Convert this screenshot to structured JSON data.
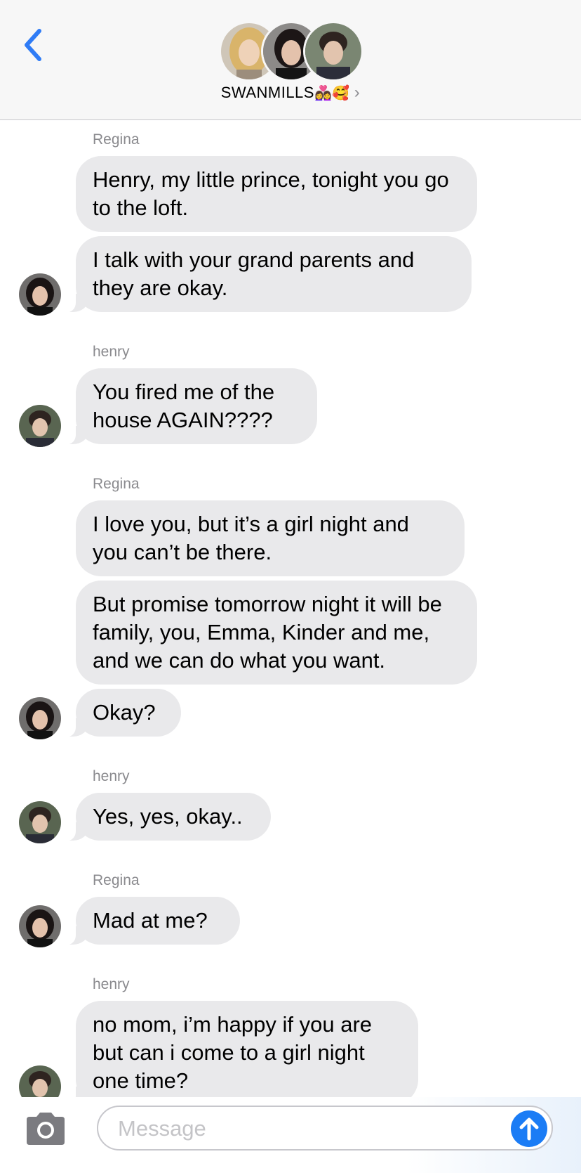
{
  "header": {
    "group_name": "SWANMILLS",
    "group_emoji": "👩‍❤️‍👩🥰",
    "chevron": "›",
    "back_icon": "chevron-left-icon",
    "accent_color": "#2f7cf6"
  },
  "messages": [
    {
      "sender": "Regina",
      "bubbles": [
        "Henry, my little prince, tonight you go to the loft.",
        "I talk with your grand parents and they are okay."
      ]
    },
    {
      "sender": "henry",
      "bubbles": [
        "You fired me of the house AGAIN????"
      ]
    },
    {
      "sender": "Regina",
      "bubbles": [
        "I love you, but it’s a girl night and you can’t be there.",
        "But promise tomorrow night it will be family, you, Emma, Kinder and me, and we can do what you want.",
        "Okay?"
      ]
    },
    {
      "sender": "henry",
      "bubbles": [
        "Yes, yes, okay.."
      ]
    },
    {
      "sender": "Regina",
      "bubbles": [
        "Mad at me?"
      ]
    },
    {
      "sender": "henry",
      "bubbles": [
        "no mom, i’m happy if you are but can i come to a girl night one time?"
      ]
    }
  ],
  "input": {
    "placeholder": "Message",
    "camera_icon": "camera-icon",
    "send_icon": "arrow-up-icon",
    "send_color": "#1b7cf5"
  }
}
